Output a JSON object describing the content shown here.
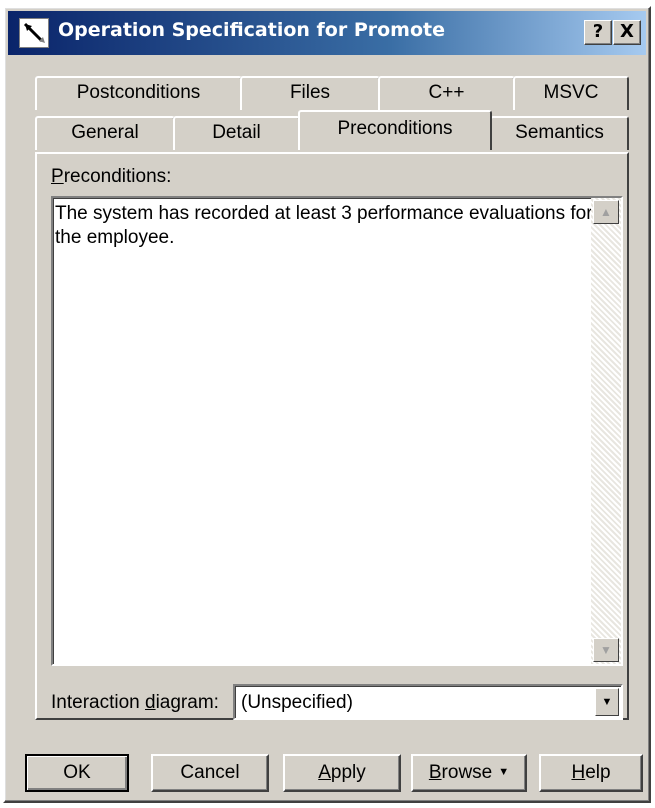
{
  "window": {
    "title": "Operation Specification for Promote",
    "app_icon": "pencil-icon",
    "help_button": "?",
    "close_button": "X"
  },
  "tabs": {
    "row_back": [
      "Postconditions",
      "Files",
      "C++",
      "MSVC"
    ],
    "row_front": [
      "General",
      "Detail",
      "Preconditions",
      "Semantics"
    ],
    "active": "Preconditions"
  },
  "preconditions": {
    "label_mnemonic": "P",
    "label_rest": "reconditions:",
    "text": "The system has recorded at least 3 performance evaluations for the employee."
  },
  "interaction_diagram": {
    "label_before": "Interaction ",
    "label_mnemonic": "d",
    "label_after": "iagram:",
    "value": "(Unspecified)"
  },
  "buttons": {
    "ok": "OK",
    "cancel": "Cancel",
    "apply_mnemonic": "A",
    "apply_rest": "pply",
    "browse_mnemonic": "B",
    "browse_rest": "rowse",
    "help_mnemonic": "H",
    "help_rest": "elp"
  },
  "icons": {
    "scroll_up": "scroll-up-icon",
    "scroll_down": "scroll-down-icon",
    "dropdown": "chevron-down-icon"
  }
}
